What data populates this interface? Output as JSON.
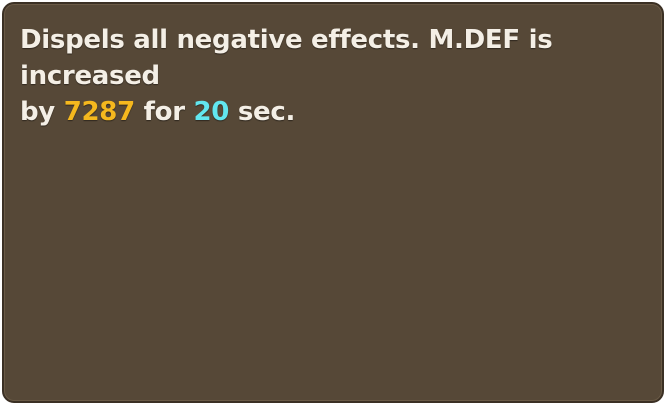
{
  "tooltip": {
    "line1": "Dispels all negative effects. M.DEF is increased",
    "line2_prefix": "by ",
    "amount": "7287",
    "line2_mid": " for ",
    "duration": "20",
    "line2_suffix": " sec."
  },
  "colors": {
    "panel_background": "#564837",
    "text": "#f4efe6",
    "amount_highlight": "#f5b81e",
    "duration_highlight": "#62e6ef"
  }
}
